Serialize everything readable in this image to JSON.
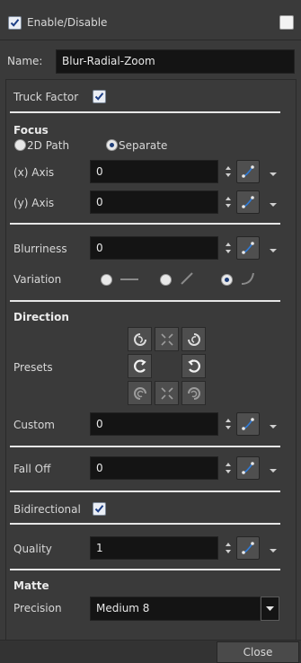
{
  "header": {
    "enable_label": "Enable/Disable",
    "enabled": true
  },
  "name_row": {
    "label": "Name:",
    "value": "Blur-Radial-Zoom"
  },
  "truck_factor": {
    "label": "Truck Factor",
    "checked": true
  },
  "focus": {
    "title": "Focus",
    "mode_2d_label": "2D Path",
    "mode_separate_label": "Separate",
    "selected_mode": "Separate",
    "x_axis": {
      "label": "(x) Axis",
      "value": "0"
    },
    "y_axis": {
      "label": "(y) Axis",
      "value": "0"
    }
  },
  "blurriness": {
    "label": "Blurriness",
    "value": "0"
  },
  "variation": {
    "label": "Variation",
    "options": [
      "constant",
      "linear",
      "ease"
    ],
    "selected": "ease"
  },
  "direction": {
    "title": "Direction",
    "presets_label": "Presets",
    "presets": [
      "rotate-ccw-icon",
      "converge-icon",
      "rotate-cw-icon",
      "turn-left-icon",
      "center-empty",
      "turn-right-icon",
      "spiral-ccw-icon",
      "diverge-icon",
      "spiral-cw-icon"
    ],
    "custom_label": "Custom",
    "custom_value": "0"
  },
  "fall_off": {
    "label": "Fall Off",
    "value": "0"
  },
  "bidirectional": {
    "label": "Bidirectional",
    "checked": true
  },
  "quality": {
    "label": "Quality",
    "value": "1"
  },
  "matte": {
    "title": "Matte",
    "precision_label": "Precision",
    "precision_value": "Medium 8"
  },
  "footer": {
    "close_label": "Close"
  },
  "colors": {
    "background": "#3a3a3a",
    "field": "#141414",
    "separator": "#e6e6e6",
    "accent_blue": "#1f4fa8"
  }
}
